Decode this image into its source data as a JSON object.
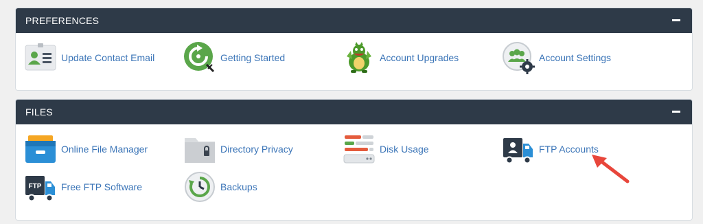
{
  "preferences": {
    "title": "PREFERENCES",
    "items": [
      {
        "label": "Update Contact Email",
        "icon": "contact-card-icon"
      },
      {
        "label": "Getting Started",
        "icon": "getting-started-icon"
      },
      {
        "label": "Account Upgrades",
        "icon": "dragon-mascot-icon"
      },
      {
        "label": "Account Settings",
        "icon": "account-settings-icon"
      }
    ]
  },
  "files": {
    "title": "FILES",
    "items": [
      {
        "label": "Online File Manager",
        "icon": "file-box-icon"
      },
      {
        "label": "Directory Privacy",
        "icon": "locked-folder-icon"
      },
      {
        "label": "Disk Usage",
        "icon": "disk-usage-icon"
      },
      {
        "label": "FTP Accounts",
        "icon": "ftp-truck-user-icon"
      },
      {
        "label": "Free FTP Software",
        "icon": "ftp-truck-icon"
      },
      {
        "label": "Backups",
        "icon": "backup-clock-icon"
      }
    ]
  },
  "colors": {
    "header_bg": "#2e3a48",
    "link": "#3a74b7",
    "annotation_arrow": "#e8463b"
  }
}
